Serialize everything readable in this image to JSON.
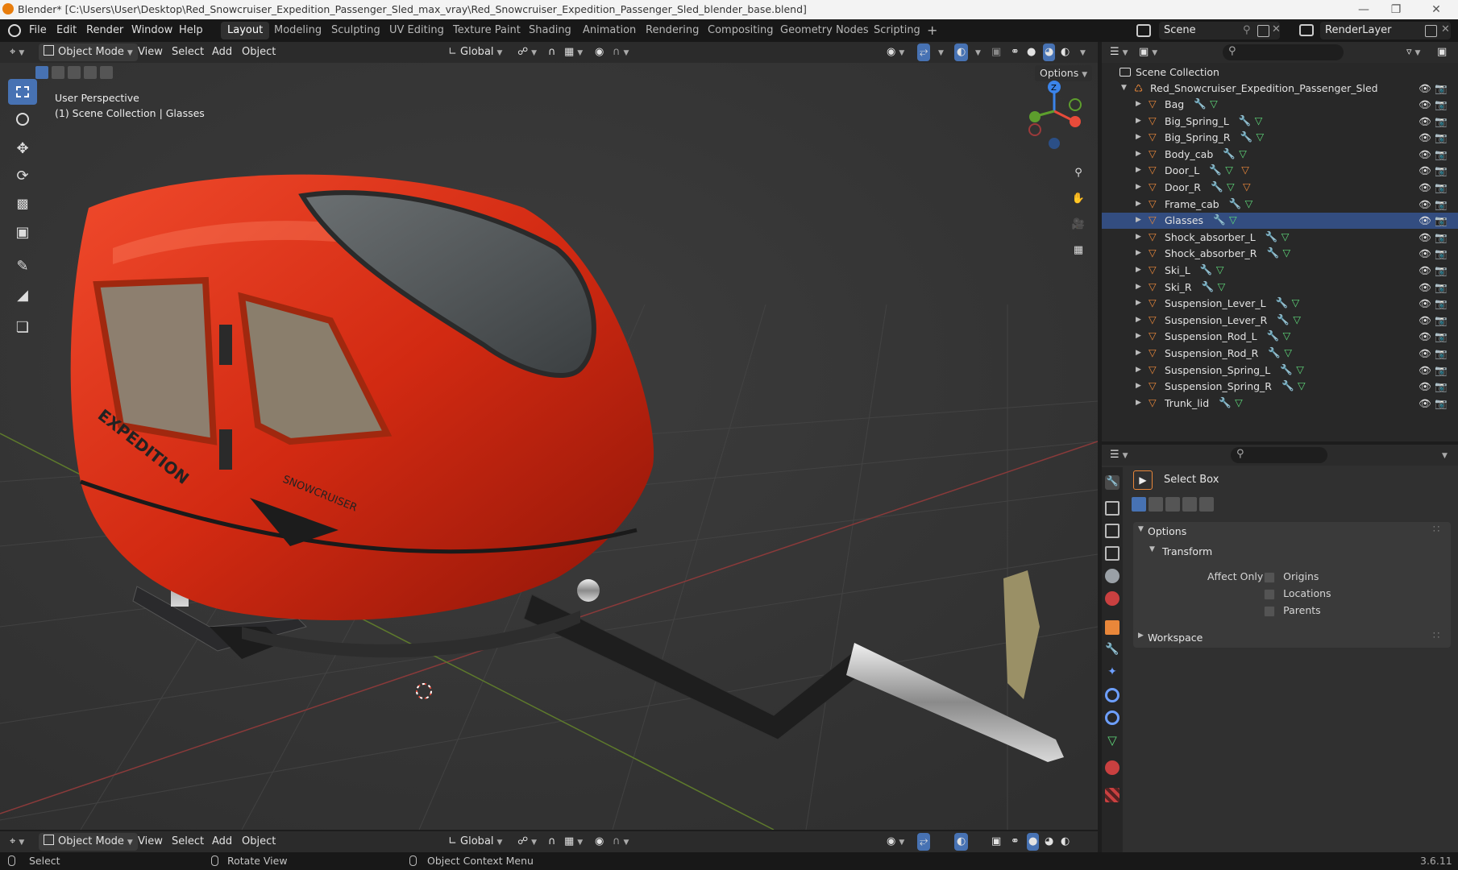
{
  "window": {
    "title": "Blender* [C:\\Users\\User\\Desktop\\Red_Snowcruiser_Expedition_Passenger_Sled_max_vray\\Red_Snowcruiser_Expedition_Passenger_Sled_blender_base.blend]"
  },
  "menu": {
    "items": [
      "File",
      "Edit",
      "Render",
      "Window",
      "Help"
    ],
    "workspaces": [
      "Layout",
      "Modeling",
      "Sculpting",
      "UV Editing",
      "Texture Paint",
      "Shading",
      "Animation",
      "Rendering",
      "Compositing",
      "Geometry Nodes",
      "Scripting"
    ],
    "active_workspace": "Layout",
    "add_tab": "+",
    "scene": "Scene",
    "render_layer": "RenderLayer"
  },
  "viewport_header": {
    "mode": "Object Mode",
    "menus": [
      "View",
      "Select",
      "Add",
      "Object"
    ],
    "orientation": "Global",
    "options_label": "Options"
  },
  "viewport": {
    "perspective": "User Perspective",
    "collection_info": "(1) Scene Collection | Glasses",
    "gizmo": {
      "z": "Z"
    },
    "decal_brand": "SNOWCRUISER",
    "decal_side": "EXPEDITION"
  },
  "outliner": {
    "root": "Scene Collection",
    "collection": "Red_Snowcruiser_Expedition_Passenger_Sled",
    "selected": "Glasses",
    "objects": [
      {
        "name": "Bag",
        "extra_mat": false
      },
      {
        "name": "Big_Spring_L",
        "extra_mat": false
      },
      {
        "name": "Big_Spring_R",
        "extra_mat": false
      },
      {
        "name": "Body_cab",
        "extra_mat": false
      },
      {
        "name": "Door_L",
        "extra_mat": true
      },
      {
        "name": "Door_R",
        "extra_mat": true
      },
      {
        "name": "Frame_cab",
        "extra_mat": false
      },
      {
        "name": "Glasses",
        "extra_mat": false
      },
      {
        "name": "Shock_absorber_L",
        "extra_mat": false
      },
      {
        "name": "Shock_absorber_R",
        "extra_mat": false
      },
      {
        "name": "Ski_L",
        "extra_mat": false
      },
      {
        "name": "Ski_R",
        "extra_mat": false
      },
      {
        "name": "Suspension_Lever_L",
        "extra_mat": false
      },
      {
        "name": "Suspension_Lever_R",
        "extra_mat": false
      },
      {
        "name": "Suspension_Rod_L",
        "extra_mat": false
      },
      {
        "name": "Suspension_Rod_R",
        "extra_mat": false
      },
      {
        "name": "Suspension_Spring_L",
        "extra_mat": false
      },
      {
        "name": "Suspension_Spring_R",
        "extra_mat": false
      },
      {
        "name": "Trunk_lid",
        "extra_mat": false
      }
    ]
  },
  "properties": {
    "tool_name": "Select Box",
    "options_label": "Options",
    "transform_label": "Transform",
    "affect_only_label": "Affect Only",
    "checkboxes": [
      {
        "label": "Origins",
        "checked": false
      },
      {
        "label": "Locations",
        "checked": false
      },
      {
        "label": "Parents",
        "checked": false
      }
    ],
    "workspace_label": "Workspace"
  },
  "status": {
    "select": "Select",
    "rotate": "Rotate View",
    "context": "Object Context Menu",
    "version": "3.6.11"
  },
  "colors": {
    "accent": "#4772b3",
    "mesh_orange": "#e9873a",
    "modifier_blue": "#6d9fff",
    "data_green": "#5fd87a",
    "selected_row": "#334d80",
    "sled_red": "#d62a12"
  }
}
